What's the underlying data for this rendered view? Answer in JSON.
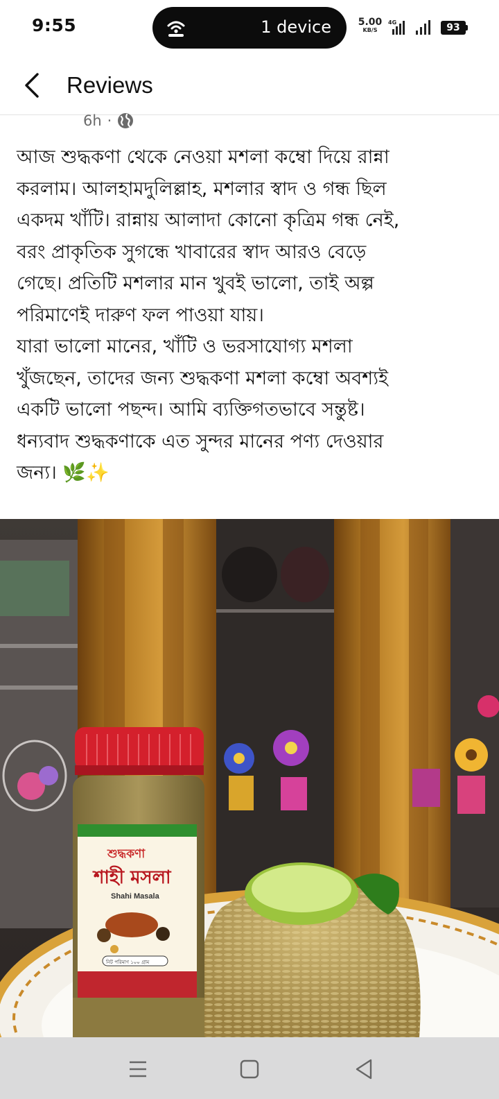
{
  "status_bar": {
    "time": "9:55",
    "pill_label": "1 device",
    "net_speed_value": "5.00",
    "net_speed_unit": "KB/S",
    "network_type": "4G",
    "battery": "93"
  },
  "header": {
    "title": "Reviews"
  },
  "post": {
    "time_ago": "6h",
    "separator": "·",
    "text": "আজ শুদ্ধকণা থেকে নেওয়া মশলা কম্বো দিয়ে রান্না\nকরলাম। আলহামদুলিল্লাহ, মশলার স্বাদ ও গন্ধ ছিল\nএকদম খাঁটি। রান্নায় আলাদা কোনো কৃত্রিম গন্ধ নেই,\nবরং প্রাকৃতিক সুগন্ধে খাবারের স্বাদ আরও বেড়ে\nগেছে। প্রতিটি মশলার মান খুবই ভালো, তাই অল্প\nপরিমাণেই দারুণ ফল পাওয়া যায়।\nযারা ভালো মানের, খাঁটি ও ভরসাযোগ্য মশলা\nখুঁজছেন, তাদের জন্য শুদ্ধকণা মশলা কম্বো অবশ্যই\nএকটি ভালো পছন্দ। আমি ব্যক্তিগতভাবে সন্তুষ্ট।\nধন্যবাদ শুদ্ধকণাকে এত সুন্দর মানের পণ্য দেওয়ার\nজন্য। 🌿✨"
  },
  "photo": {
    "jar_brand": "শুদ্ধকণা",
    "jar_product_bn": "শাহী মসলা",
    "jar_product_en": "Shahi Masala",
    "jar_weight": "নিট পরিমাণ ১০০ গ্রাম",
    "colors": {
      "cabinet_wood": "#a86d1e",
      "cabinet_dark": "#3a2f2b",
      "jar_lid": "#d4202c",
      "jar_label_green": "#2f8f2f",
      "rice": "#b9a05a",
      "lime": "#b8d86a"
    }
  },
  "nav_bar": {
    "icons": [
      "menu-icon",
      "home-square-icon",
      "back-triangle-icon"
    ]
  },
  "colors": {
    "background": "#ffffff",
    "text": "#141414",
    "muted": "#6b6b6b",
    "nav_bg": "#dadadb"
  }
}
